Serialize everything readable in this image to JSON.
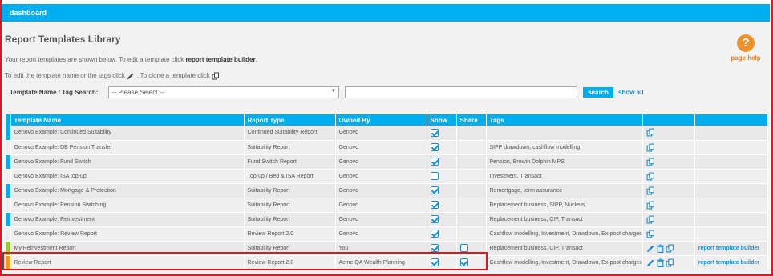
{
  "header": {
    "title": "dashboard"
  },
  "page": {
    "title": "Report Templates Library",
    "intro_prefix": "Your report templates are shown below. To edit a template click ",
    "intro_link": "report template builder",
    "intro_suffix": ".",
    "edit_hint_prefix": "To edit the template name or the tags click",
    "edit_hint_middle": ". To clone a template click"
  },
  "help": {
    "label": "page help",
    "symbol": "?"
  },
  "search": {
    "label": "Template Name / Tag Search:",
    "select_value": "-- Please Select --",
    "input_value": "",
    "button_label": "search",
    "show_all_label": "show all"
  },
  "table": {
    "columns": [
      "Template Name",
      "Report Type",
      "Owned By",
      "Show",
      "Share",
      "Tags",
      "",
      ""
    ],
    "rows": [
      {
        "name": "Genovo Example: Continued Suitability",
        "type": "Continued Suitability Report",
        "owner": "Genovo",
        "show": true,
        "share": null,
        "tags": "",
        "actions": "clone",
        "builder": "",
        "stripe": "blue"
      },
      {
        "name": "Genovo Example: DB Pension Transfer",
        "type": "Suitability Report",
        "owner": "Genovo",
        "show": true,
        "share": null,
        "tags": "SIPP drawdown, cashflow modelling",
        "actions": "clone",
        "builder": "",
        "stripe": "blue"
      },
      {
        "name": "Genovo Example: Fund Switch",
        "type": "Fund Switch Report",
        "owner": "Genovo",
        "show": true,
        "share": null,
        "tags": "Pension, Brewin Dolphin MPS",
        "actions": "clone",
        "builder": "",
        "stripe": "blue"
      },
      {
        "name": "Genovo Example: ISA top-up",
        "type": "Top-up / Bed & ISA Report",
        "owner": "Genovo",
        "show": false,
        "share": null,
        "tags": "Investment, Transact",
        "actions": "clone",
        "builder": "",
        "stripe": "blue"
      },
      {
        "name": "Genovo Example: Mortgage & Protection",
        "type": "Suitability Report",
        "owner": "Genovo",
        "show": true,
        "share": null,
        "tags": "Remortgage, term assurance",
        "actions": "clone",
        "builder": "",
        "stripe": "blue"
      },
      {
        "name": "Genovo Example: Pension Switching",
        "type": "Suitability Report",
        "owner": "Genovo",
        "show": true,
        "share": null,
        "tags": "Replacement business, SIPP, Nucleus",
        "actions": "clone",
        "builder": "",
        "stripe": "blue"
      },
      {
        "name": "Genovo Example: Reinvestment",
        "type": "Suitability Report",
        "owner": "Genovo",
        "show": true,
        "share": null,
        "tags": "Replacement business, CIP, Transact",
        "actions": "clone",
        "builder": "",
        "stripe": "blue"
      },
      {
        "name": "Genovo Example: Review Report",
        "type": "Review Report 2.0",
        "owner": "Genovo",
        "show": true,
        "share": null,
        "tags": "Cashflow modelling, Investment, Drawdown, Ex-post charges",
        "actions": "clone",
        "builder": "",
        "stripe": "blue"
      },
      {
        "name": "My Reinvestment Report",
        "type": "Suitability Report",
        "owner": "You",
        "show": true,
        "share": false,
        "tags": "Replacement business, CIP, Transact",
        "actions": "full",
        "builder": "report template builder",
        "stripe": "green"
      },
      {
        "name": "Review Report",
        "type": "Review Report 2.0",
        "owner": "Acme QA Wealth Planning",
        "show": true,
        "share": true,
        "tags": "Cashflow modelling, Investment, Drawdown, Ex-post charges",
        "actions": "full",
        "builder": "report template builder",
        "stripe": "orange"
      }
    ]
  },
  "colors": {
    "accent": "#00adee",
    "highlight": "#e8141b",
    "help": "#f0902a"
  }
}
